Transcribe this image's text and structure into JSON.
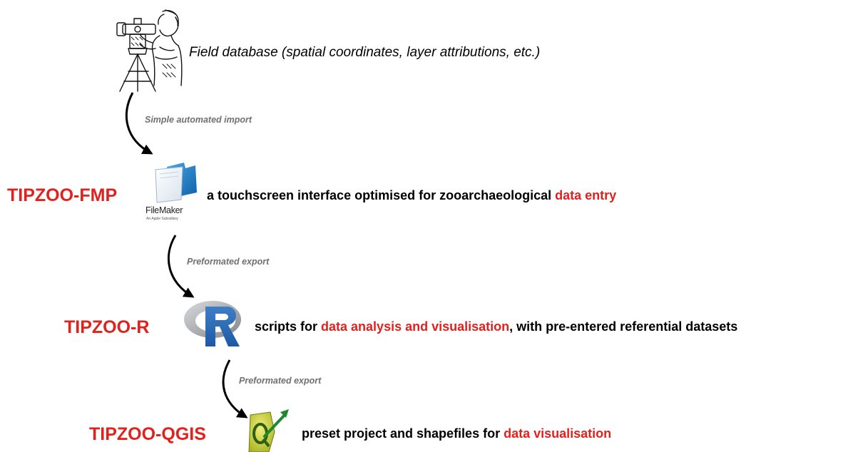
{
  "field": {
    "text": "Field database (spatial coordinates, layer attributions, etc.)",
    "icon": "surveyor-theodolite-icon"
  },
  "arrows": [
    {
      "label": "Simple automated import"
    },
    {
      "label": "Preformated export"
    },
    {
      "label": "Preformated export"
    }
  ],
  "tools": [
    {
      "name": "TIPZOO-FMP",
      "icon": "filemaker-logo-icon",
      "logo_text": "FileMaker",
      "logo_subtext": "An Apple Subsidiary",
      "desc_pre": "a touchscreen interface optimised for zooarchaeological ",
      "desc_hl": "data entry",
      "desc_post": ""
    },
    {
      "name": "TIPZOO-R",
      "icon": "r-logo-icon",
      "desc_pre": "scripts for ",
      "desc_hl": "data analysis and visualisation",
      "desc_post": ", with pre-entered referential datasets"
    },
    {
      "name": "TIPZOO-QGIS",
      "icon": "qgis-logo-icon",
      "desc_pre": "preset project and shapefiles for ",
      "desc_hl": "data visualisation",
      "desc_post": ""
    }
  ],
  "colors": {
    "highlight": "#e0211d",
    "text": "#000000",
    "arrow_label": "#707070"
  }
}
